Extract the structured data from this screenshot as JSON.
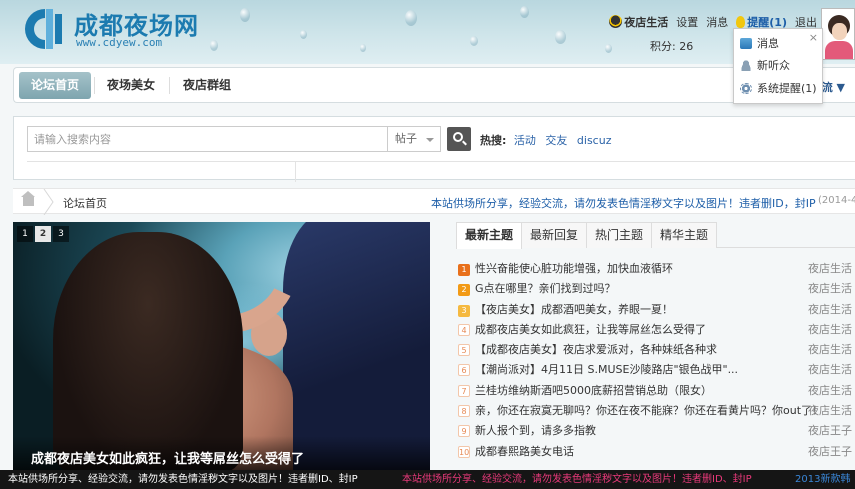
{
  "site": {
    "name": "成都夜场网",
    "url": "www.cdyew.com"
  },
  "topnav": {
    "nightlife": "夜店生活",
    "settings": "设置",
    "messages": "消息",
    "remind": "提醒(1)",
    "logout": "退出",
    "credits": "积分: 26"
  },
  "dropdown": {
    "close": "×",
    "items": [
      "消息",
      "新听众",
      "系统提醒(1)"
    ]
  },
  "nav": {
    "tabs": [
      "论坛首页",
      "夜场美女",
      "夜店群组"
    ],
    "right_fragment": "流 ▼"
  },
  "search": {
    "placeholder": "请输入搜索内容",
    "type": "帖子",
    "hot_label": "热搜:",
    "hot_keywords": [
      "活动",
      "交友",
      "discuz"
    ]
  },
  "breadcrumb": {
    "current": "论坛首页",
    "notice": "本站供场所分享，经验交流，请勿发表色情淫秽文字以及图片！违者删ID，封IP",
    "date": "(2014-4-"
  },
  "slideshow": {
    "pages": [
      "1",
      "2",
      "3"
    ],
    "active": 1,
    "caption": "成都夜店美女如此疯狂，让我等屌丝怎么受得了"
  },
  "topics": {
    "tabs": [
      "最新主题",
      "最新回复",
      "热门主题",
      "精华主题"
    ],
    "items": [
      {
        "num": "1",
        "title": "性兴奋能使心脏功能增强，加快血液循环",
        "author": "夜店生活"
      },
      {
        "num": "2",
        "title": "G点在哪里？亲们找到过吗？",
        "author": "夜店生活"
      },
      {
        "num": "3",
        "title": "【夜店美女】成都酒吧美女，养眼一夏！",
        "author": "夜店生活"
      },
      {
        "num": "4",
        "title": "成都夜店美女如此疯狂，让我等屌丝怎么受得了",
        "author": "夜店生活"
      },
      {
        "num": "5",
        "title": "【成都夜店美女】夜店求爱派对，各种妹纸各种求",
        "author": "夜店生活"
      },
      {
        "num": "6",
        "title": "【潮尚派对】4月11日 S.MUSE沙陵路店\"银色战甲\"...",
        "author": "夜店生活"
      },
      {
        "num": "7",
        "title": "兰桂坊维纳斯酒吧5000底薪招营销总助（限女）",
        "author": "夜店生活"
      },
      {
        "num": "8",
        "title": "亲，你还在寂寞无聊吗？你还在夜不能寐？你还在看黄片吗？你out了！",
        "author": "夜店生活"
      },
      {
        "num": "9",
        "title": "新人报个到，请多多指教",
        "author": "夜店王子"
      },
      {
        "num": "10",
        "title": "成都春熙路美女电话",
        "author": "夜店王子"
      }
    ]
  },
  "ticker": {
    "msg1": "本站供场所分享、经验交流，请勿发表色情淫秽文字以及图片！违者删ID、封IP",
    "msg2": "本站供场所分享、经验交流，请勿发表色情淫秽文字以及图片！违者删ID、封IP",
    "msg3": "2013新款韩"
  },
  "colors": {
    "brand": "#1c7bb0",
    "link": "#1d5ea8",
    "accent_active_tab": "#8fb2bb",
    "ticker_pink": "#e8397a"
  }
}
